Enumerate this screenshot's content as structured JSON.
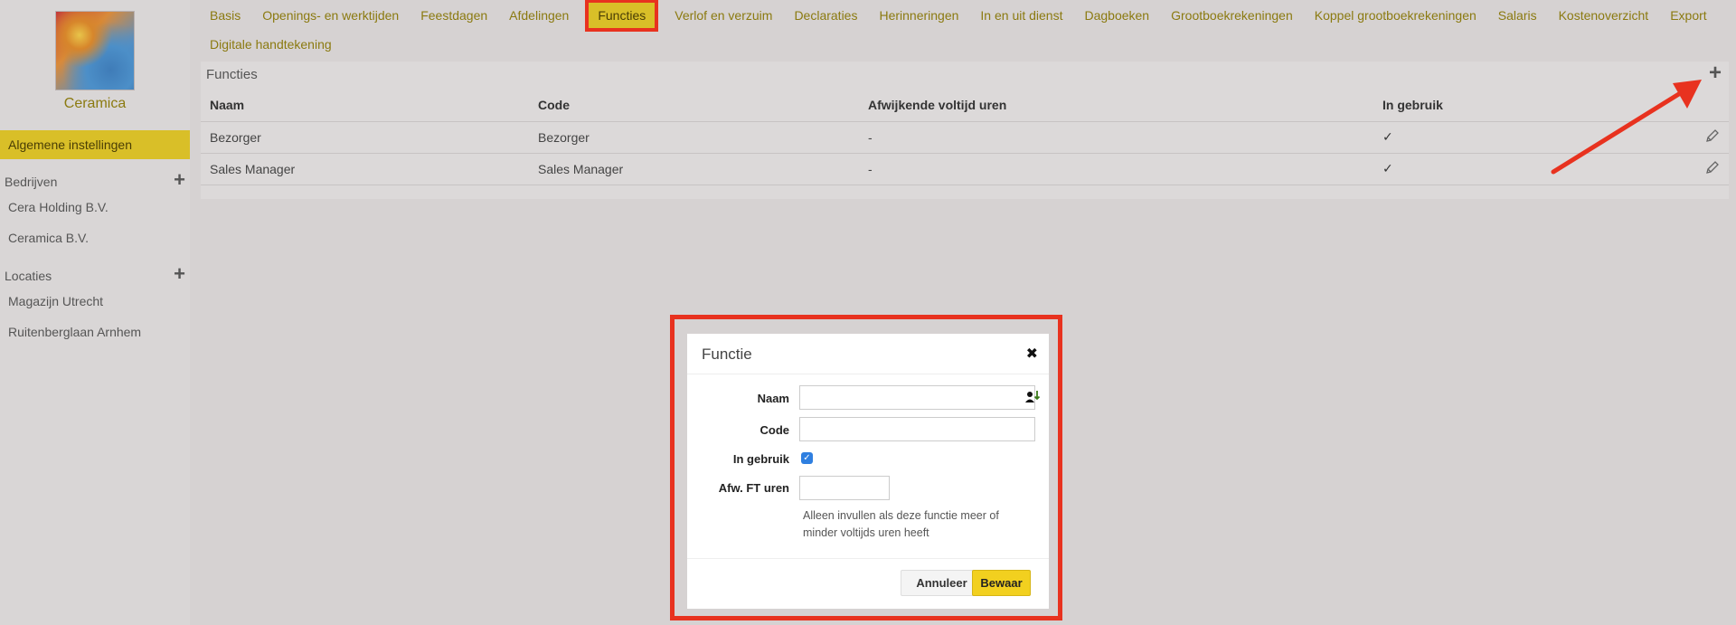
{
  "sidebar": {
    "company_name": "Ceramica",
    "active_item": "Algemene instellingen",
    "companies_header": "Bedrijven",
    "companies": [
      "Cera Holding B.V.",
      "Ceramica B.V."
    ],
    "locations_header": "Locaties",
    "locations": [
      "Magazijn Utrecht",
      "Ruitenberglaan Arnhem"
    ],
    "plus_glyph": "+"
  },
  "tabs": {
    "items": [
      "Basis",
      "Openings- en werktijden",
      "Feestdagen",
      "Afdelingen",
      "Functies",
      "Verlof en verzuim",
      "Declaraties",
      "Herinneringen",
      "In en uit dienst",
      "Dagboeken",
      "Grootboekrekeningen",
      "Koppel grootboekrekeningen",
      "Salaris",
      "Kostenoverzicht",
      "Export",
      "Digitale handtekening"
    ],
    "active": "Functies"
  },
  "panel": {
    "title": "Functies",
    "add_glyph": "+",
    "columns": [
      "Naam",
      "Code",
      "Afwijkende voltijd uren",
      "In gebruik"
    ],
    "rows": [
      {
        "naam": "Bezorger",
        "code": "Bezorger",
        "afw": "-",
        "in_gebruik": "✓"
      },
      {
        "naam": "Sales Manager",
        "code": "Sales Manager",
        "afw": "-",
        "in_gebruik": "✓"
      }
    ]
  },
  "modal": {
    "title": "Functie",
    "close_glyph": "✖",
    "fields": {
      "naam_label": "Naam",
      "naam_value": "",
      "code_label": "Code",
      "code_value": "",
      "in_gebruik_label": "In gebruik",
      "in_gebruik_checked": true,
      "afw_label": "Afw. FT uren",
      "afw_value": "",
      "afw_hint": "Alleen invullen als deze functie meer of minder voltijds uren heeft"
    },
    "cancel_label": "Annuleer",
    "save_label": "Bewaar"
  },
  "colors": {
    "accent": "#d9bf28",
    "link": "#8b7a10",
    "annotation": "#e8321f",
    "checkbox": "#2f7fe0"
  },
  "icons": {
    "edit": "pencil-icon",
    "check": "check-icon",
    "add": "plus-icon",
    "person": "person-icon",
    "close": "close-icon"
  }
}
